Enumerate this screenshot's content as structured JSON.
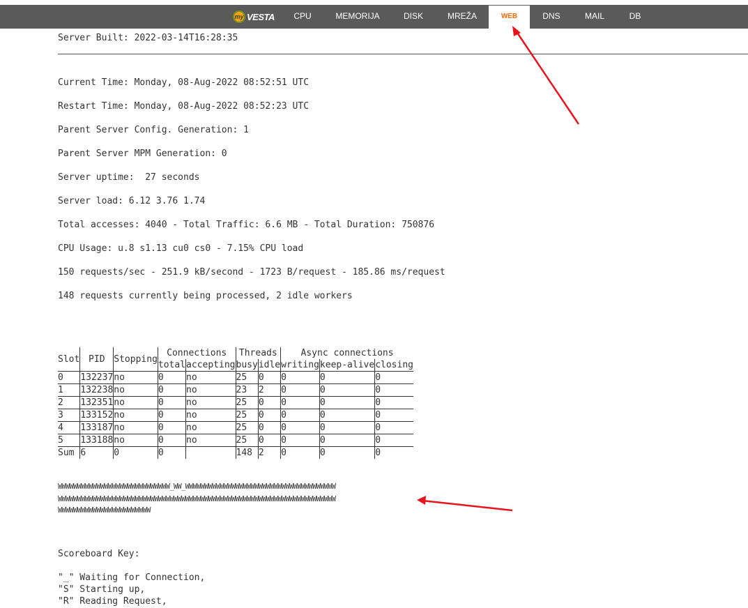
{
  "nav": {
    "logo": "VESTA",
    "logo_prefix": "my",
    "items": [
      {
        "label": "CPU"
      },
      {
        "label": "MEMORIJA"
      },
      {
        "label": "DISK"
      },
      {
        "label": "MREŽA"
      },
      {
        "label": "WEB"
      },
      {
        "label": "DNS"
      },
      {
        "label": "MAIL"
      },
      {
        "label": "DB"
      }
    ],
    "active": "WEB",
    "active_color": "#ff6a00",
    "bg_color": "#5a5a5a"
  },
  "status": {
    "server_built": "Server Built: 2022-03-14T16:28:35",
    "lines": [
      "Current Time: Monday, 08-Aug-2022 08:52:51 UTC",
      "Restart Time: Monday, 08-Aug-2022 08:52:23 UTC",
      "Parent Server Config. Generation: 1",
      "Parent Server MPM Generation: 0",
      "Server uptime:  27 seconds",
      "Server load: 6.12 3.76 1.74",
      "Total accesses: 4040 - Total Traffic: 6.6 MB - Total Duration: 750876",
      "CPU Usage: u.8 s1.13 cu0 cs0 - 7.15% CPU load",
      "150 requests/sec - 251.9 kB/second - 1723 B/request - 185.86 ms/request",
      "148 requests currently being processed, 2 idle workers"
    ]
  },
  "table": {
    "headers": {
      "slot": "Slot",
      "pid": "PID",
      "stopping": "Stopping",
      "connections": "Connections",
      "threads": "Threads",
      "async": "Async connections",
      "total": "total",
      "accepting": "accepting",
      "busy": "busy",
      "idle": "idle",
      "writing": "writing",
      "keepalive": "keep-alive",
      "closing": "closing"
    },
    "rows": [
      [
        "0",
        "132237",
        "no",
        "0",
        "no",
        "25",
        "0",
        "0",
        "0",
        "0"
      ],
      [
        "1",
        "132238",
        "no",
        "0",
        "no",
        "23",
        "2",
        "0",
        "0",
        "0"
      ],
      [
        "2",
        "132351",
        "no",
        "0",
        "no",
        "25",
        "0",
        "0",
        "0",
        "0"
      ],
      [
        "3",
        "133152",
        "no",
        "0",
        "no",
        "25",
        "0",
        "0",
        "0",
        "0"
      ],
      [
        "4",
        "133187",
        "no",
        "0",
        "no",
        "25",
        "0",
        "0",
        "0",
        "0"
      ],
      [
        "5",
        "133188",
        "no",
        "0",
        "no",
        "25",
        "0",
        "0",
        "0",
        "0"
      ],
      [
        "Sum",
        "6",
        "0",
        "0",
        "",
        "148",
        "2",
        "0",
        "0",
        "0"
      ]
    ]
  },
  "scoreboard": {
    "lines": [
      "WWWWWWWWWWWWWWWWWWWWWWWWWWWWW_WW_WWWWWWWWWWWWWWWWWWWWWWWWWWWWWWWWWWWWWWW",
      "WWWWWWWWWWWWWWWWWWWWWWWWWWWWWWWWWWWWWWWWWWWWWWWWWWWWWWWWWWWWWWWWWWWWWWWW",
      "WWWWWWWWWWWWWWWWWWWWWWWW"
    ]
  },
  "key": {
    "title": "Scoreboard Key:",
    "items": [
      "\"_\" Waiting for Connection,",
      "\"S\" Starting up,",
      "\"R\" Reading Request,"
    ]
  },
  "annotation_color": "#e8141b"
}
